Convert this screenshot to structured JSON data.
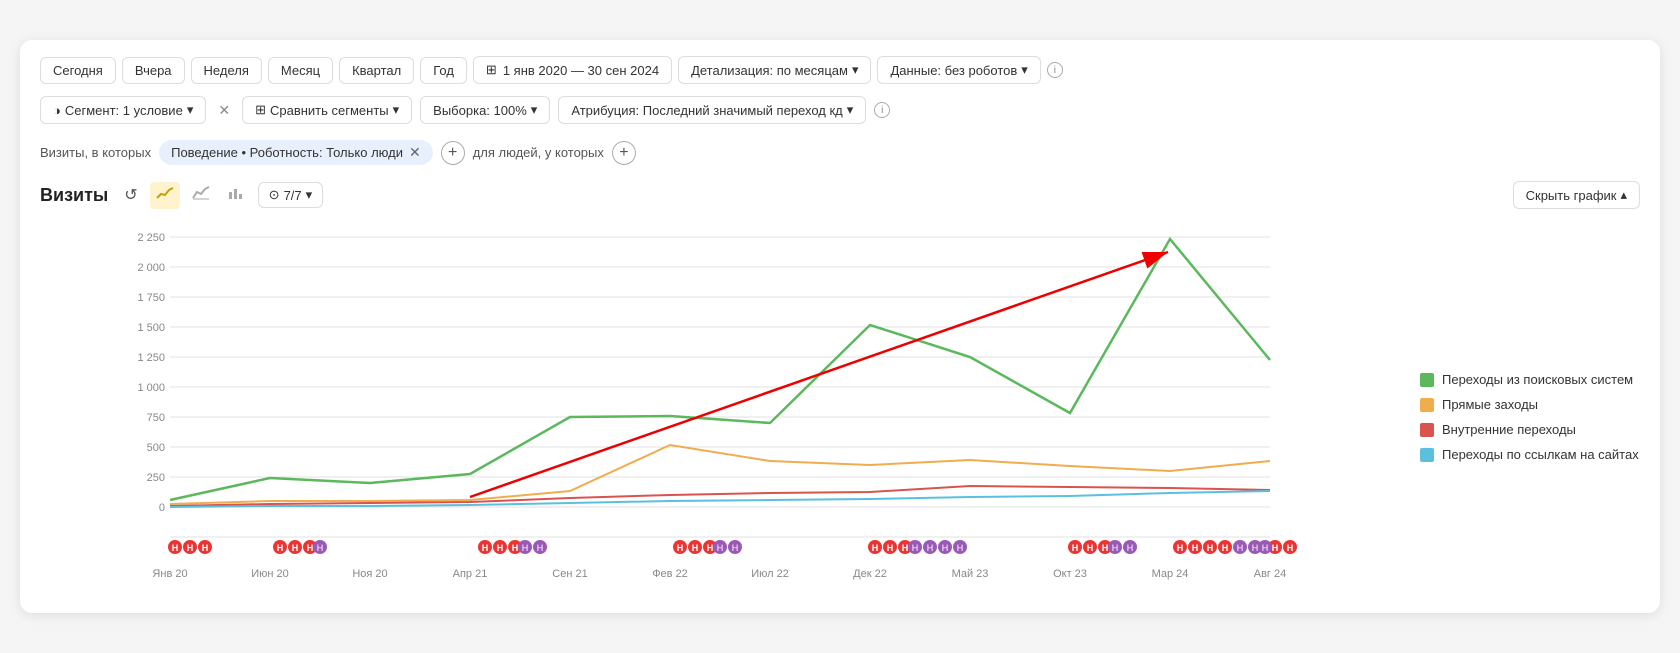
{
  "topBar": {
    "buttons": [
      "Сегодня",
      "Вчера",
      "Неделя",
      "Месяц",
      "Квартал",
      "Год"
    ],
    "dateRange": "1 янв 2020 — 30 сен 2024",
    "detail": "Детализация: по месяцам",
    "data": "Данные: без роботов"
  },
  "secondBar": {
    "segment": "Сегмент: 1 условие",
    "compare": "Сравнить сегменты",
    "sample": "Выборка: 100%",
    "attribution": "Атрибуция: Последний значимый переход  кд"
  },
  "filterRow": {
    "label": "Визиты, в которых",
    "tag": "Поведение • Роботность: Только люди",
    "forLabel": "для людей, у которых"
  },
  "chartHeader": {
    "title": "Визиты",
    "metrics": "7/7",
    "hideBtn": "Скрыть график"
  },
  "yAxis": {
    "labels": [
      "2 250",
      "2 000",
      "1 750",
      "1 500",
      "1 250",
      "1 000",
      "750",
      "500",
      "250",
      "0"
    ]
  },
  "xAxis": {
    "labels": [
      "Янв 20",
      "Июн 20",
      "Ноя 20",
      "Апр 21",
      "Сен 21",
      "Фев 22",
      "Июл 22",
      "Дек 22",
      "Май 23",
      "Окт 23",
      "Мар 24",
      "Авг 24"
    ]
  },
  "legend": [
    {
      "label": "Переходы из поисковых систем",
      "color": "#5cb85c"
    },
    {
      "label": "Прямые заходы",
      "color": "#f0ad4e"
    },
    {
      "label": "Внутренние переходы",
      "color": "#d9534f"
    },
    {
      "label": "Переходы по ссылкам на сайтах",
      "color": "#5bc0de"
    }
  ]
}
